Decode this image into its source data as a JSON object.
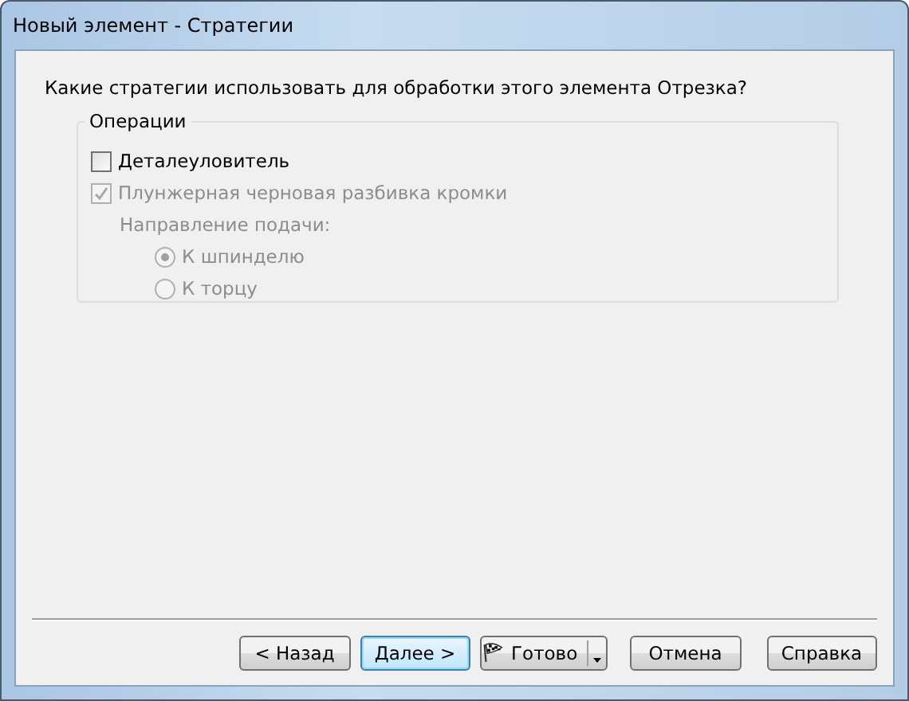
{
  "window": {
    "title": "Новый элемент - Стратегии"
  },
  "question": "Какие стратегии использовать для обработки этого элемента Отрезка?",
  "group": {
    "title": "Операции",
    "options": [
      {
        "label": "Деталеуловитель",
        "checked": false,
        "disabled": false
      },
      {
        "label": "Плунжерная черновая разбивка кромки",
        "checked": true,
        "disabled": true
      }
    ],
    "feed_direction": {
      "label": "Направление подачи:",
      "disabled": true,
      "choices": [
        {
          "label": "К шпинделю",
          "selected": true
        },
        {
          "label": "К торцу",
          "selected": false
        }
      ]
    }
  },
  "buttons": [
    {
      "label": "< Назад",
      "kind": "plain",
      "default": false
    },
    {
      "label": "Далее >",
      "kind": "plain",
      "default": true
    },
    {
      "label": "Готово",
      "kind": "split",
      "default": false
    },
    {
      "label": "Отмена",
      "kind": "plain",
      "default": false
    },
    {
      "label": "Справка",
      "kind": "plain",
      "default": false
    }
  ]
}
